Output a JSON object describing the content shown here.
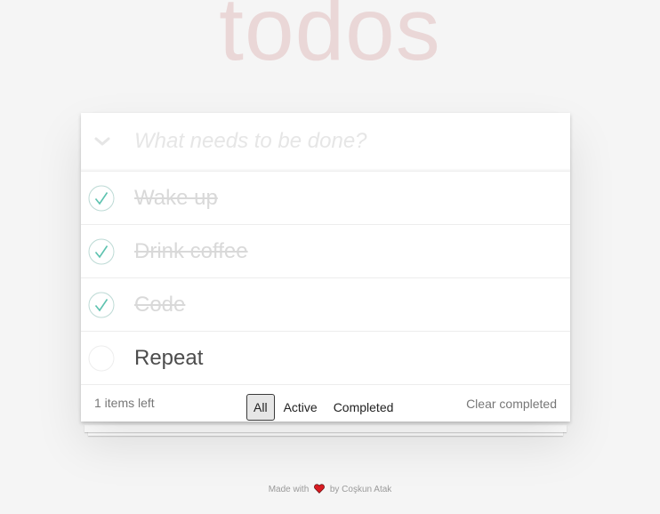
{
  "app": {
    "title": "todos"
  },
  "input": {
    "placeholder": "What needs to be done?",
    "value": "",
    "toggle_icon": "chevron-down-icon"
  },
  "todos": [
    {
      "label": "Wake up",
      "completed": true
    },
    {
      "label": "Drink coffee",
      "completed": true
    },
    {
      "label": "Code",
      "completed": true
    },
    {
      "label": "Repeat",
      "completed": false
    }
  ],
  "footer": {
    "items_left": "1 items left",
    "filters": [
      {
        "label": "All",
        "selected": true
      },
      {
        "label": "Active",
        "selected": false
      },
      {
        "label": "Completed",
        "selected": false
      }
    ],
    "clear_completed": "Clear completed"
  },
  "credit": {
    "prefix": "Made with",
    "icon": "heart-icon",
    "suffix": "by Coşkun Atak"
  },
  "colors": {
    "title": "#efd5d5",
    "check": "#5dc2af",
    "completed_text": "#d9d9d9",
    "heart": "#d81b22"
  }
}
